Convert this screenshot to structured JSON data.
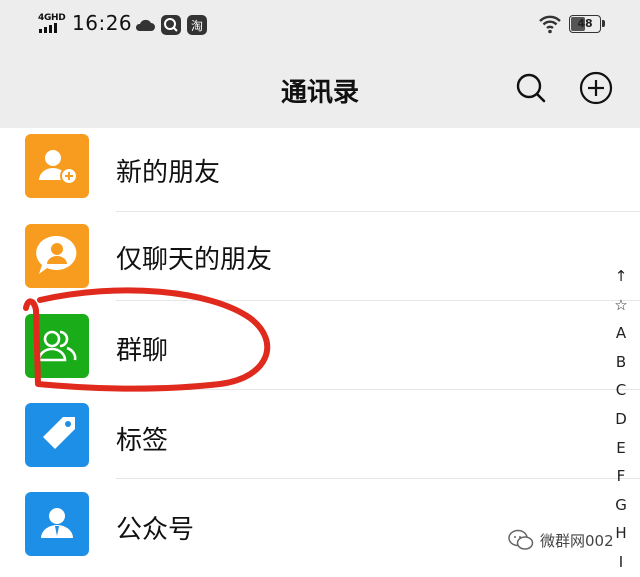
{
  "status_bar": {
    "network": "4GHD",
    "time": "16:26",
    "battery": "48"
  },
  "header": {
    "title": "通讯录"
  },
  "list": {
    "items": [
      {
        "label": "新的朋友",
        "icon": "add-friend-icon",
        "color": "#f79c1e"
      },
      {
        "label": "仅聊天的朋友",
        "icon": "chat-only-friend-icon",
        "color": "#f79c1e"
      },
      {
        "label": "群聊",
        "icon": "group-chat-icon",
        "color": "#1aad19"
      },
      {
        "label": "标签",
        "icon": "tag-icon",
        "color": "#1e8fe6"
      },
      {
        "label": "公众号",
        "icon": "official-account-icon",
        "color": "#1e8fe6"
      }
    ]
  },
  "index_bar": [
    "↑",
    "☆",
    "A",
    "B",
    "C",
    "D",
    "E",
    "F",
    "G",
    "H",
    "I"
  ],
  "watermark": {
    "text": "微群网002"
  },
  "annotation": {
    "color": "#e02a1e"
  }
}
